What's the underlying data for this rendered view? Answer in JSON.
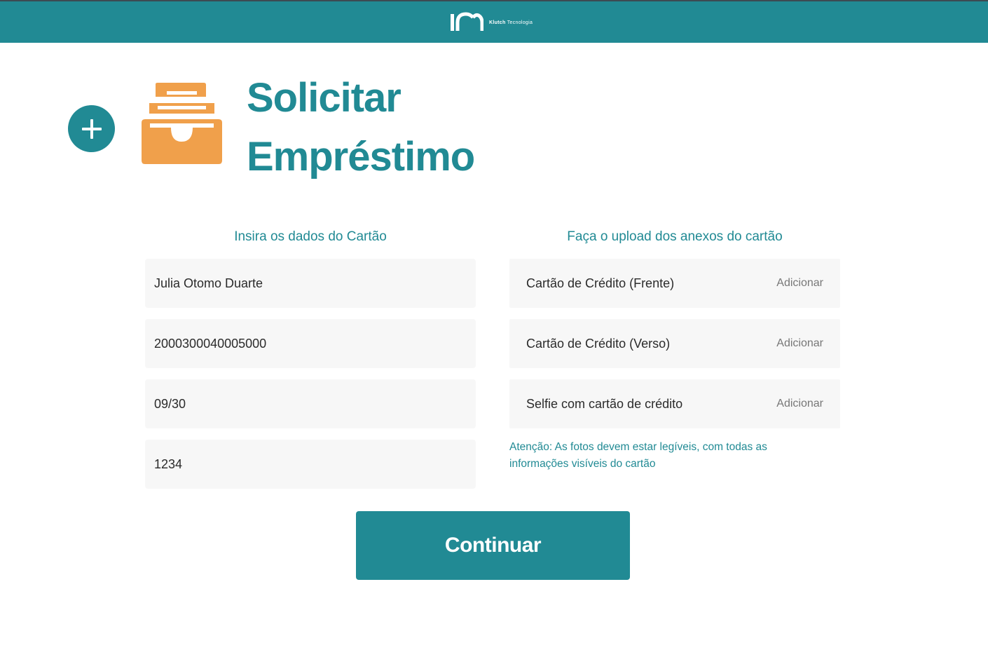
{
  "header": {
    "brand_name": "Klutch",
    "brand_suffix": "Tecnologia",
    "bg_color": "#218a94"
  },
  "title": {
    "line1": "Solicitar",
    "line2": "Empréstimo"
  },
  "icons": {
    "add": "plus-icon",
    "drawer": "inbox-drawer-icon"
  },
  "card_form": {
    "heading": "Insira os dados do Cartão",
    "fields": [
      {
        "value": "Julia Otomo Duarte"
      },
      {
        "value": "2000300040005000"
      },
      {
        "value": "09/30"
      },
      {
        "value": "1234"
      }
    ]
  },
  "uploads": {
    "heading": "Faça o upload dos anexos do cartão",
    "items": [
      {
        "label": "Cartão de Crédito (Frente)",
        "action": "Adicionar"
      },
      {
        "label": "Cartão de Crédito (Verso)",
        "action": "Adicionar"
      },
      {
        "label": "Selfie com cartão de crédito",
        "action": "Adicionar"
      }
    ],
    "note": "Atenção: As fotos devem estar legíveis, com todas as informações visíveis do cartão"
  },
  "actions": {
    "continue_label": "Continuar"
  },
  "colors": {
    "primary": "#218a94",
    "accent": "#f0a04b",
    "field_bg": "#f7f7f7"
  }
}
